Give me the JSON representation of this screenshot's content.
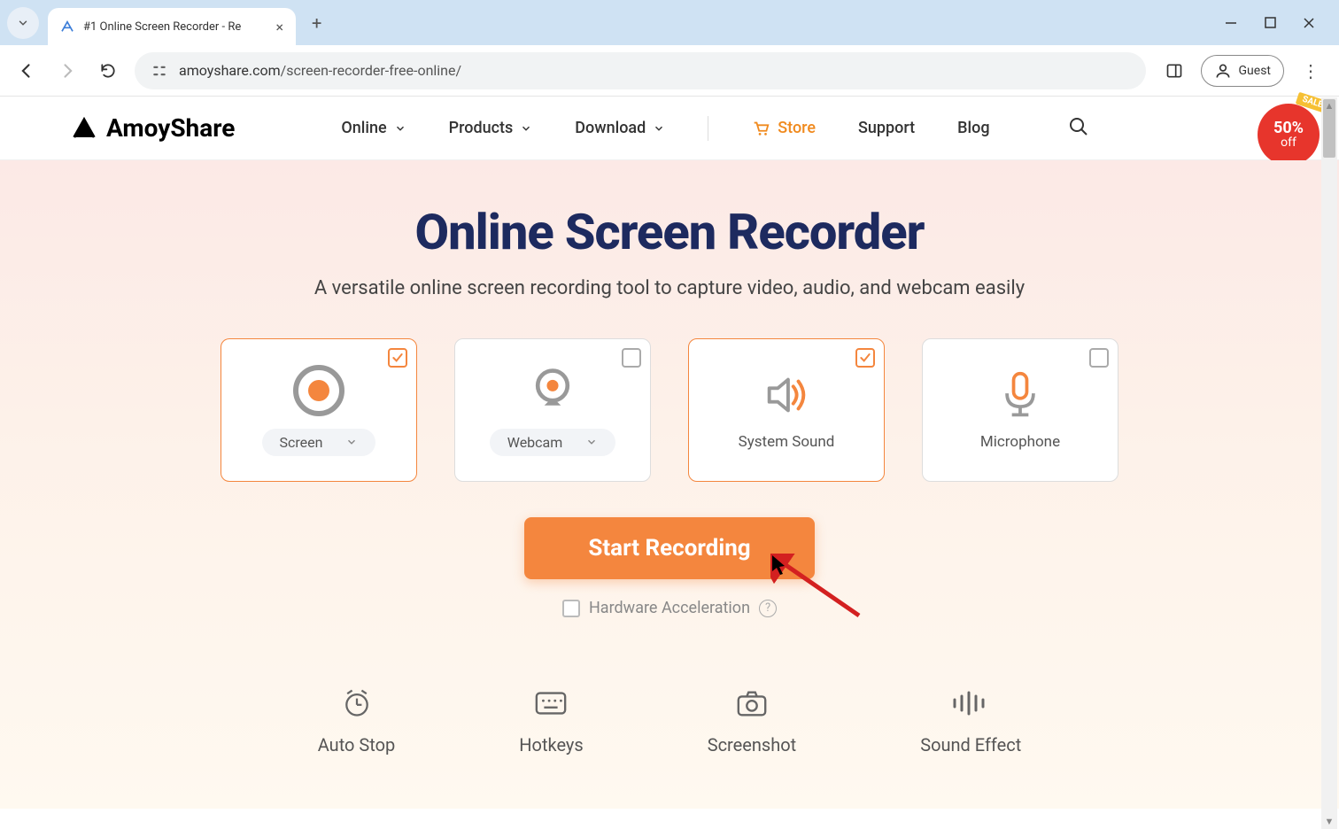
{
  "browser": {
    "tab_title": "#1 Online Screen Recorder - Re",
    "url_prefix": "amoyshare.com",
    "url_path": "/screen-recorder-free-online/",
    "guest_label": "Guest"
  },
  "header": {
    "brand": "AmoyShare",
    "nav": {
      "online": "Online",
      "products": "Products",
      "download": "Download",
      "store": "Store",
      "support": "Support",
      "blog": "Blog"
    },
    "sale": {
      "ribbon": "SALE",
      "percent": "50%",
      "off": "off"
    }
  },
  "hero": {
    "title": "Online Screen Recorder",
    "subtitle": "A versatile online screen recording tool to capture video, audio, and webcam easily",
    "options": {
      "screen": "Screen",
      "webcam": "Webcam",
      "system_sound": "System Sound",
      "microphone": "Microphone"
    },
    "start_button": "Start Recording",
    "hw_accel": "Hardware Acceleration"
  },
  "features": {
    "auto_stop": "Auto Stop",
    "hotkeys": "Hotkeys",
    "screenshot": "Screenshot",
    "sound_effect": "Sound Effect"
  }
}
